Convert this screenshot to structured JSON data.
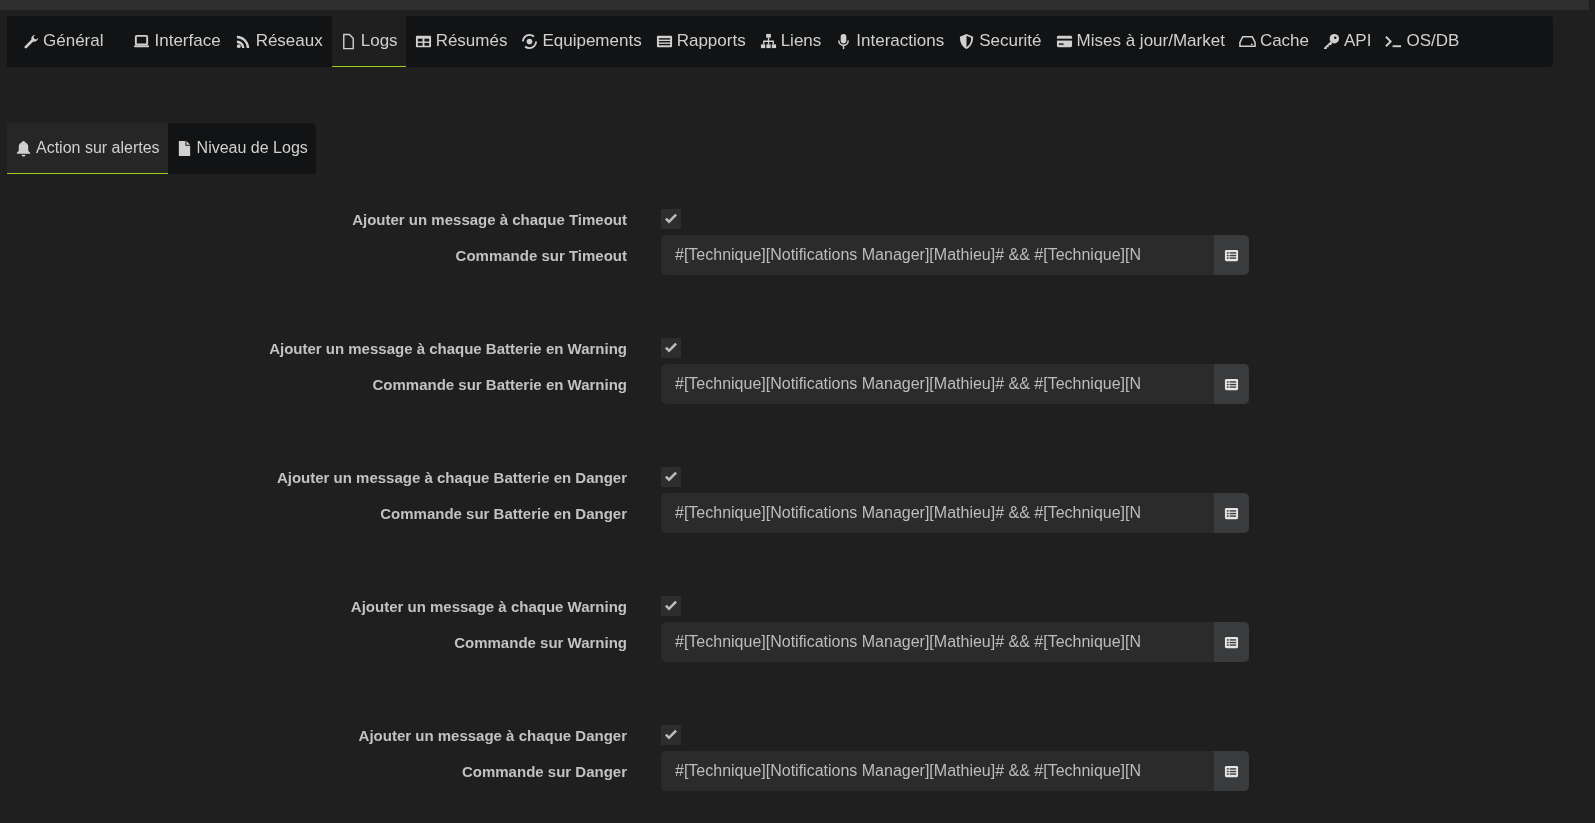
{
  "tabs": [
    {
      "label": "Général",
      "selected": false
    },
    {
      "label": "Interface",
      "selected": false
    },
    {
      "label": "Réseaux",
      "selected": false
    },
    {
      "label": "Logs",
      "selected": true
    },
    {
      "label": "Résumés",
      "selected": false
    },
    {
      "label": "Equipements",
      "selected": false
    },
    {
      "label": "Rapports",
      "selected": false
    },
    {
      "label": "Liens",
      "selected": false
    },
    {
      "label": "Interactions",
      "selected": false
    },
    {
      "label": "Securité",
      "selected": false
    },
    {
      "label": "Mises à jour/Market",
      "selected": false
    },
    {
      "label": "Cache",
      "selected": false
    },
    {
      "label": "API",
      "selected": false
    },
    {
      "label": "OS/DB",
      "selected": false
    }
  ],
  "subtabs": [
    {
      "label": "Action sur alertes",
      "selected": true
    },
    {
      "label": "Niveau de Logs",
      "selected": false
    }
  ],
  "alerts": [
    {
      "message_label": "Ajouter un message à chaque Timeout",
      "checked": true,
      "command_label": "Commande sur Timeout",
      "command_value": "#[Technique][Notifications Manager][Mathieu]# && #[Technique][N"
    },
    {
      "message_label": "Ajouter un message à chaque Batterie en Warning",
      "checked": true,
      "command_label": "Commande sur Batterie en Warning",
      "command_value": "#[Technique][Notifications Manager][Mathieu]# && #[Technique][N"
    },
    {
      "message_label": "Ajouter un message à chaque Batterie en Danger",
      "checked": true,
      "command_label": "Commande sur Batterie en Danger",
      "command_value": "#[Technique][Notifications Manager][Mathieu]# && #[Technique][N"
    },
    {
      "message_label": "Ajouter un message à chaque Warning",
      "checked": true,
      "command_label": "Commande sur Warning",
      "command_value": "#[Technique][Notifications Manager][Mathieu]# && #[Technique][N"
    },
    {
      "message_label": "Ajouter un message à chaque Danger",
      "checked": true,
      "command_label": "Commande sur Danger",
      "command_value": "#[Technique][Notifications Manager][Mathieu]# && #[Technique][N"
    }
  ]
}
